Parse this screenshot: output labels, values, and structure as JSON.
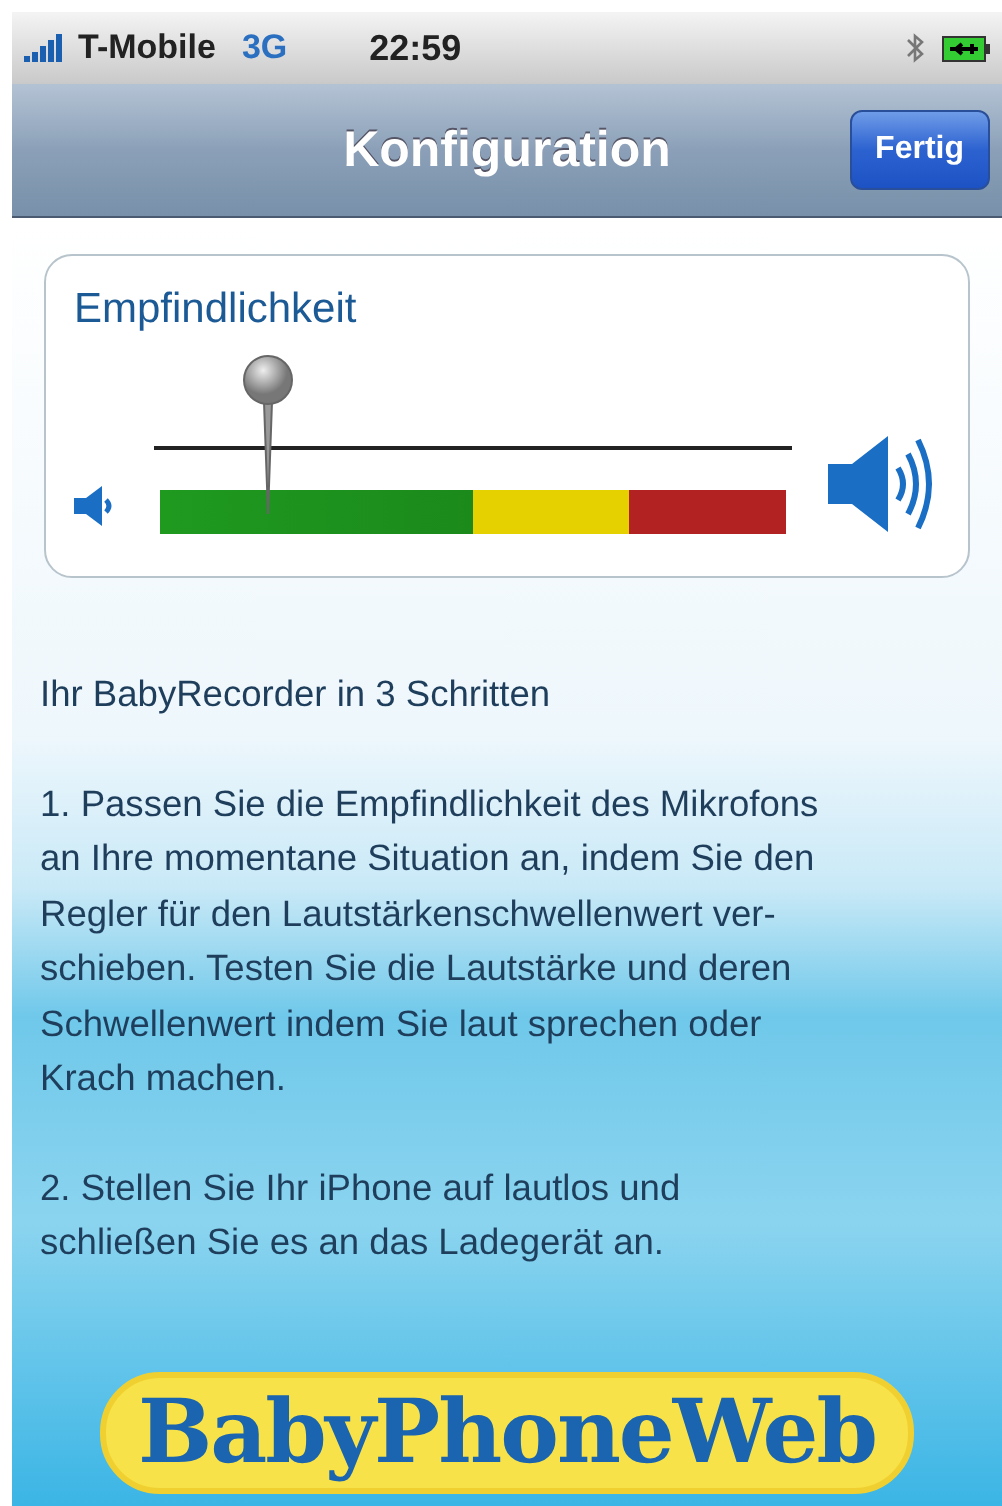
{
  "status_bar": {
    "carrier": "T-Mobile",
    "network": "3G",
    "time": "22:59"
  },
  "nav_bar": {
    "title": "Konfiguration",
    "done_button": "Fertig"
  },
  "sensitivity": {
    "label": "Empfindlichkeit",
    "level": 0.18
  },
  "instructions": {
    "heading": "Ihr BabyRecorder in 3 Schritten",
    "paragraphs": [
      "1. Passen Sie die Empfindlichkeit des Mikrofons\nan Ihre momentane Situation an, indem Sie den\nRegler für den Lautstärkenschwellenwert ver-\nschieben. Testen Sie die Lautstärke und deren\nSchwellenwert indem Sie laut sprechen oder\nKrach machen.",
      "2. Stellen Sie Ihr iPhone auf lautlos und\nschließen Sie es an das Ladegerät an."
    ]
  },
  "logo": {
    "text": "BabyPhoneWeb"
  }
}
